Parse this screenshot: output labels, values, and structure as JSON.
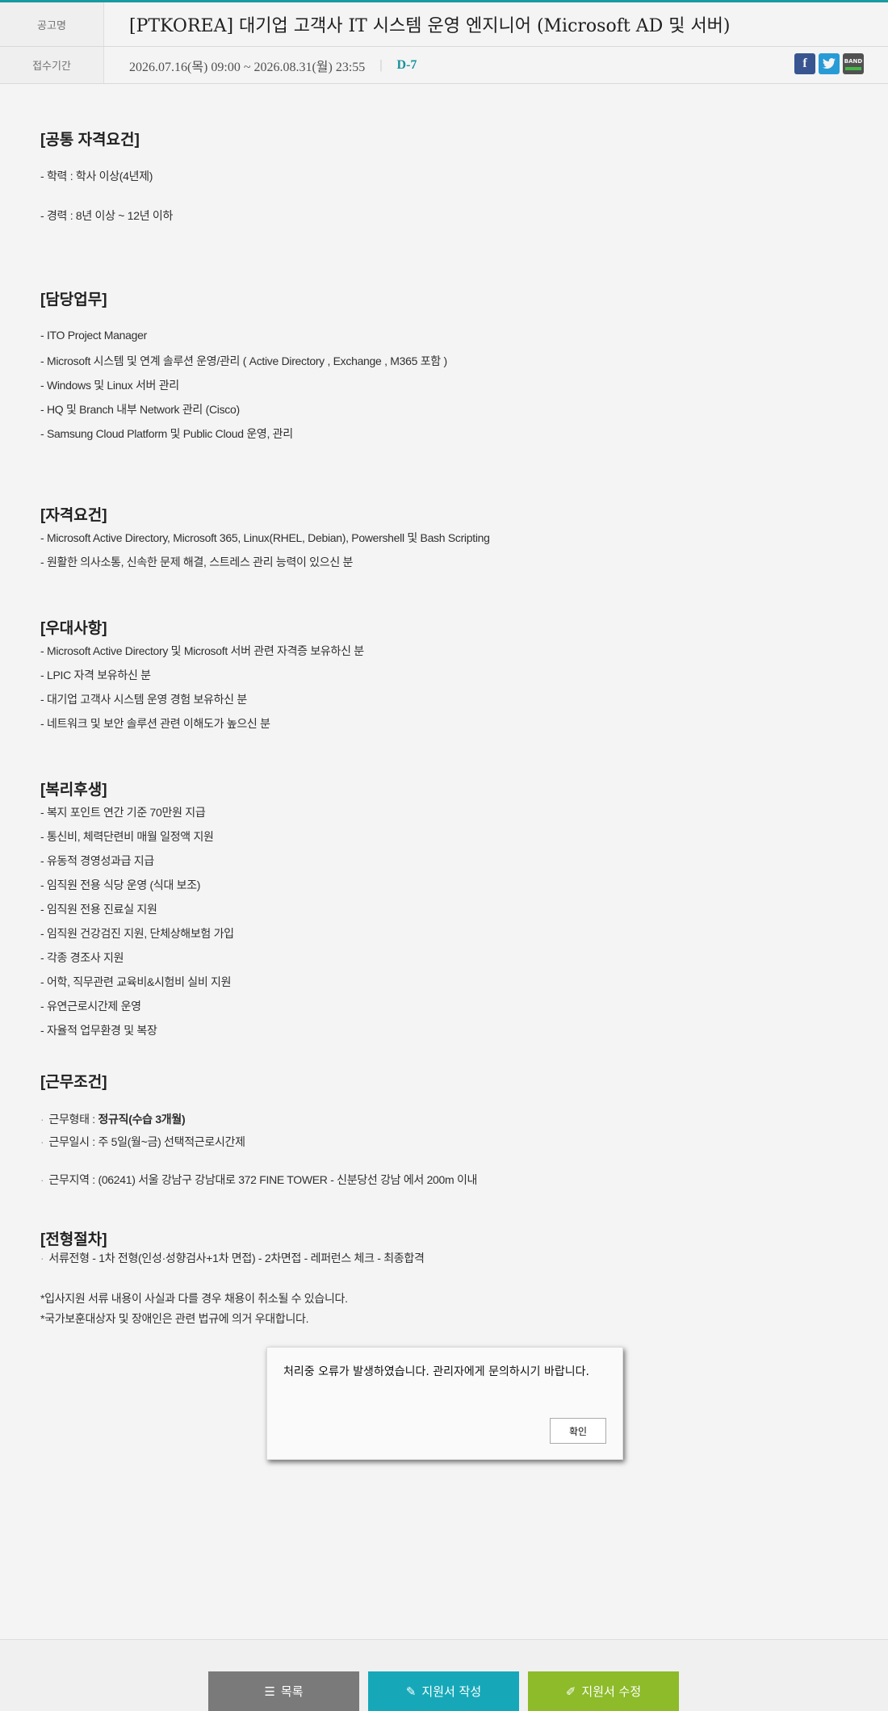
{
  "header": {
    "title_label": "공고명",
    "title": "[PTKOREA] 대기업 고객사 IT 시스템 운영 엔지니어 (Microsoft AD 및 서버)",
    "period_label": "접수기간",
    "period": "2026.07.16(목) 09:00 ~ 2026.08.31(월) 23:55",
    "dday": "D-7",
    "share": {
      "facebook": "f",
      "band": "BAND"
    }
  },
  "sections": {
    "common": {
      "title": "[공통 자격요건]",
      "items": [
        "- 학력 : 학사 이상(4년제)",
        "- 경력 : 8년 이상 ~ 12년 이하"
      ]
    },
    "duties": {
      "title": "[담당업무]",
      "items": [
        "- ITO Project Manager",
        "- Microsoft 시스템 및 연계 솔루션 운영/관리 ( Active Directory , Exchange , M365 포함 )",
        "- Windows 및 Linux 서버 관리",
        "- HQ 및 Branch 내부 Network 관리 (Cisco)",
        "- Samsung Cloud Platform 및 Public Cloud 운영, 관리"
      ]
    },
    "qualifications": {
      "title": "[자격요건]",
      "items": [
        "- Microsoft Active Directory, Microsoft 365, Linux(RHEL, Debian), Powershell 및 Bash Scripting",
        "- 원활한 의사소통, 신속한 문제 해결, 스트레스 관리 능력이 있으신 분"
      ]
    },
    "preferred": {
      "title": "[우대사항]",
      "items": [
        "- Microsoft Active Directory 및 Microsoft 서버 관련 자격증 보유하신 분",
        "- LPIC 자격 보유하신 분",
        "- 대기업 고객사 시스템 운영 경험 보유하신 분",
        "- 네트워크 및 보안 솔루션 관련 이해도가 높으신 분"
      ]
    },
    "benefits": {
      "title": "[복리후생]",
      "items": [
        "- 복지 포인트 연간 기준 70만원 지급",
        "- 통신비, 체력단련비 매월 일정액 지원",
        "- 유동적 경영성과급 지급",
        "- 임직원 전용 식당 운영 (식대 보조)",
        "- 임직원 전용 진료실 지원",
        "- 임직원 건강검진 지원, 단체상해보험 가입",
        "- 각종 경조사 지원",
        "- 어학, 직무관련 교육비&시험비 실비 지원",
        "- 유연근로시간제 운영",
        "- 자율적 업무환경 및 복장"
      ]
    },
    "conditions": {
      "title": "[근무조건]",
      "type_label": "근무형태 : ",
      "type_value": "정규직(수습 3개월)",
      "days": "근무일시 : 주 5일(월~금) 선택적근로시간제",
      "location": "근무지역 : (06241) 서울 강남구 강남대로 372 FINE TOWER - 신분당선 강남 에서 200m 이내"
    },
    "process": {
      "title": "[전형절차]",
      "steps": "서류전형 - 1차 전형(인성·성향검사+1차 면접) - 2차면접 - 레퍼런스 체크 - 최종합격",
      "notes": [
        "*입사지원 서류 내용이 사실과 다를 경우 채용이 취소될 수 있습니다.",
        "*국가보훈대상자 및 장애인은 관련 법규에 의거 우대합니다."
      ]
    }
  },
  "dialog": {
    "message": "처리중 오류가 발생하였습니다. 관리자에게 문의하시기 바랍니다.",
    "ok_label": "확인"
  },
  "footer": {
    "list_label": "목록",
    "apply_label": "지원서 작성",
    "edit_label": "지원서 수정"
  }
}
